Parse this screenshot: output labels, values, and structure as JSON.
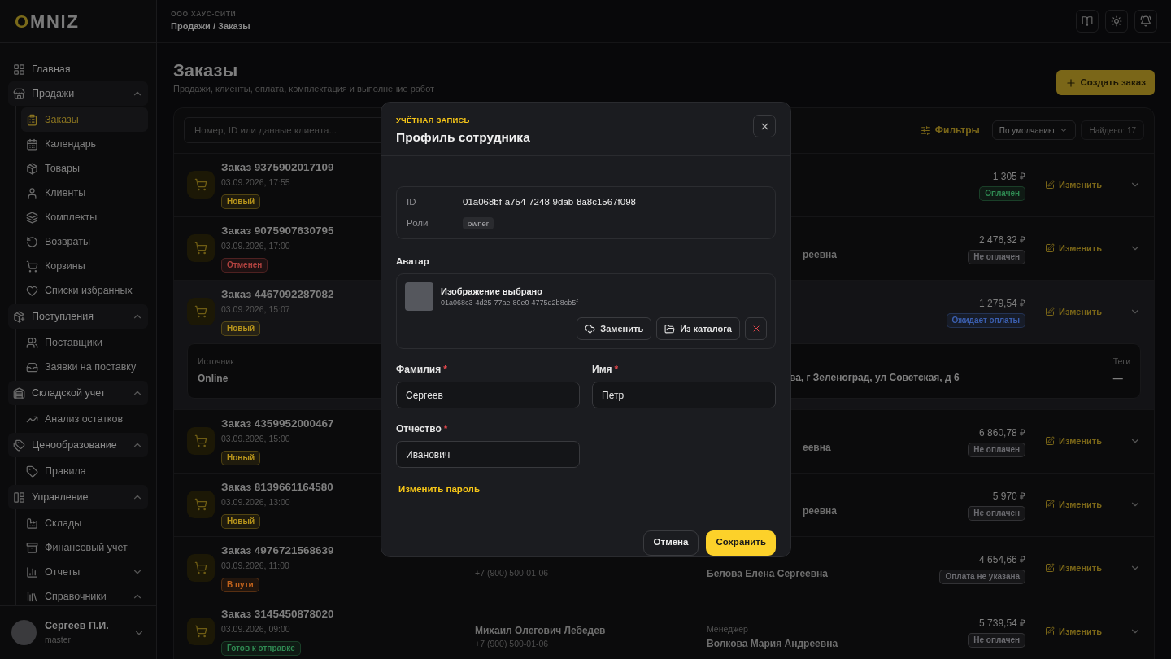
{
  "brand": {
    "logo": "OMNIZ"
  },
  "sidebar": {
    "items": [
      {
        "label": "Главная",
        "selected": false
      },
      {
        "label": "Продажи",
        "selected": false,
        "expanded": true,
        "children": [
          {
            "label": "Заказы",
            "selected": true
          },
          {
            "label": "Календарь",
            "selected": false
          },
          {
            "label": "Товары",
            "selected": false
          },
          {
            "label": "Клиенты",
            "selected": false
          },
          {
            "label": "Комплекты",
            "selected": false
          },
          {
            "label": "Возвраты",
            "selected": false
          },
          {
            "label": "Корзины",
            "selected": false
          },
          {
            "label": "Списки избранных",
            "selected": false
          }
        ]
      },
      {
        "label": "Поступления",
        "selected": false,
        "expanded": true,
        "children": [
          {
            "label": "Поставщики",
            "selected": false
          },
          {
            "label": "Заявки на поставку",
            "selected": false
          }
        ]
      },
      {
        "label": "Складской учет",
        "selected": false,
        "expanded": true,
        "children": [
          {
            "label": "Анализ остатков",
            "selected": false
          }
        ]
      },
      {
        "label": "Ценообразование",
        "selected": false,
        "expanded": true,
        "children": [
          {
            "label": "Правила",
            "selected": false
          }
        ]
      },
      {
        "label": "Управление",
        "selected": false,
        "expanded": true,
        "children": [
          {
            "label": "Склады",
            "selected": false
          },
          {
            "label": "Финансовый учет",
            "selected": false
          },
          {
            "label": "Отчеты",
            "selected": false,
            "expanded": false
          },
          {
            "label": "Справочники",
            "selected": false,
            "expanded": true
          }
        ]
      }
    ],
    "user": {
      "name": "Сергеев П.И.",
      "role": "master"
    }
  },
  "header": {
    "company": "ООО ХАУС-СИТИ",
    "breadcrumb": "Продажи / Заказы"
  },
  "page": {
    "title": "Заказы",
    "subtitle": "Продажи, клиенты, оплата, комплектация и выполнение работ",
    "create_button": "Создать заказ"
  },
  "toolbar": {
    "search_placeholder": "Номер, ID или данные клиента...",
    "filters": "Фильтры",
    "sort": "По умолчанию",
    "found": "Найдено: 17"
  },
  "orders": [
    {
      "title": "Заказ 9375902017109",
      "date": "03.09.2026, 17:55",
      "status": {
        "label": "Новый",
        "color": "#b8951c"
      },
      "amount": "1 305 ₽",
      "payment": {
        "label": "Оплачен",
        "color": "#2f8a52"
      },
      "action": "Изменить"
    },
    {
      "title": "Заказ 9075907630795",
      "date": "03.09.2026, 17:00",
      "status": {
        "label": "Отменен",
        "color": "#b0423f"
      },
      "manager": {
        "kind": "partial",
        "name": "реевна"
      },
      "amount": "2 476,32 ₽",
      "payment": {
        "label": "Не оплачен",
        "color": "#6b6b70"
      },
      "action": "Изменить"
    },
    {
      "title": "Заказ 4467092287082",
      "date": "03.09.2026, 15:07",
      "status": {
        "label": "Новый",
        "color": "#b8951c"
      },
      "amount": "1 279,54 ₽",
      "payment": {
        "label": "Ожидает оплаты",
        "color": "#3b5fb0"
      },
      "action": "Изменить",
      "details": [
        {
          "kind": "field",
          "label": "Источник",
          "value": "Online"
        },
        {
          "kind": "partial",
          "value": "ва, г Зеленоград, ул Советская, д 6"
        },
        {
          "kind": "field",
          "label": "Теги",
          "value": "—"
        }
      ]
    },
    {
      "title": "Заказ 4359952000467",
      "date": "03.09.2026, 15:00",
      "status": {
        "label": "Новый",
        "color": "#b8951c"
      },
      "manager": {
        "kind": "partial",
        "name": "еевна"
      },
      "amount": "6 860,78 ₽",
      "payment": {
        "label": "Не оплачен",
        "color": "#6b6b70"
      },
      "action": "Изменить"
    },
    {
      "title": "Заказ 8139661164580",
      "date": "03.09.2026, 13:00",
      "status": {
        "label": "Новый",
        "color": "#b8951c"
      },
      "manager": {
        "kind": "partial",
        "name": "реевна"
      },
      "amount": "5 970 ₽",
      "payment": {
        "label": "Не оплачен",
        "color": "#6b6b70"
      },
      "action": "Изменить"
    },
    {
      "title": "Заказ 4976721568639",
      "date": "03.09.2026, 11:00",
      "status": {
        "label": "В пути",
        "color": "#c2631c"
      },
      "client": {
        "phone": "+7 (900) 500-01-06"
      },
      "manager": {
        "kind": "full",
        "name": "Белова Елена Сергеевна"
      },
      "amount": "4 654,66 ₽",
      "payment": {
        "label": "Оплата не указана",
        "color": "#6b6b70"
      },
      "action": "Изменить"
    },
    {
      "title": "Заказ 3145450878020",
      "date": "03.09.2026, 09:00",
      "status": {
        "label": "Готов к отправке",
        "color": "#2f8a52"
      },
      "client": {
        "name": "Михаил Олегович Лебедев",
        "phone": "+7 (900) 500-01-06"
      },
      "manager": {
        "kind": "full",
        "label": "Менеджер",
        "name": "Волкова Мария Андреевна"
      },
      "amount": "5 739,54 ₽",
      "payment": {
        "label": "Не оплачен",
        "color": "#6b6b70"
      },
      "action": "Изменить"
    }
  ],
  "dialog": {
    "eyebrow": "УЧЁТНАЯ ЗАПИСЬ",
    "title": "Профиль сотрудника",
    "info": [
      {
        "label": "ID",
        "value": "01a068bf-a754-7248-9dab-8a8c1567f098",
        "kind": "text"
      },
      {
        "label": "Роли",
        "value": "owner",
        "kind": "tag"
      }
    ],
    "avatar": {
      "label": "Аватар",
      "status": "Изображение выбрано",
      "file_id": "01a068c3-4d25-77ae-80e0-4775d2b8cb5f",
      "replace": "Заменить",
      "catalog": "Из каталога"
    },
    "fields": [
      {
        "label": "Фамилия",
        "value": "Сергеев",
        "required": true
      },
      {
        "label": "Имя",
        "value": "Петр",
        "required": true
      },
      {
        "label": "Отчество",
        "value": "Иванович",
        "required": true
      }
    ],
    "required_mark": "*",
    "change_password": "Изменить пароль",
    "cancel": "Отмена",
    "save": "Сохранить"
  }
}
